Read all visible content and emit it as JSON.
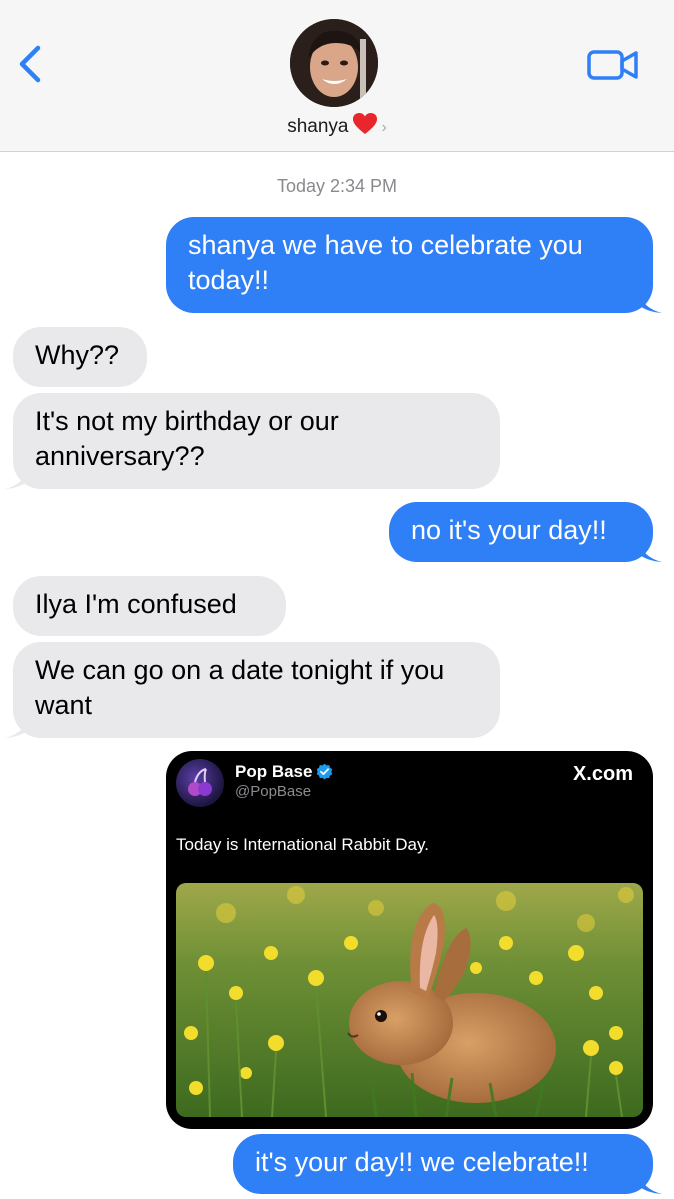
{
  "header": {
    "contact_name": "shanya",
    "back_icon": "chevron-left-icon",
    "video_icon": "video-camera-icon",
    "heart_icon": "red-heart-icon",
    "chevron_icon": "chevron-right-icon",
    "accent_color": "#2f7ff6"
  },
  "conversation": {
    "timestamp": "Today 2:34 PM",
    "messages": [
      {
        "from": "me",
        "text": "shanya we have to celebrate you today!!"
      },
      {
        "from": "them",
        "text": "Why??"
      },
      {
        "from": "them",
        "text": "It's not my birthday or our anniversary??"
      },
      {
        "from": "me",
        "text": "no it's your day!!"
      },
      {
        "from": "them",
        "text": "Ilya I'm confused"
      },
      {
        "from": "them",
        "text": "We can go on a date tonight if you want"
      },
      {
        "from": "me",
        "text": "it's your day!! we celebrate!!"
      }
    ]
  },
  "link_card": {
    "account_name": "Pop Base",
    "handle": "@PopBase",
    "site": "X.com",
    "tweet_text": "Today is International Rabbit Day.",
    "verified_icon": "verified-badge-icon",
    "image_subject": "rabbit-in-flower-field"
  },
  "colors": {
    "outgoing_bubble": "#2f7ff6",
    "incoming_bubble": "#e9e9eb",
    "header_bg": "#f6f6f7"
  }
}
